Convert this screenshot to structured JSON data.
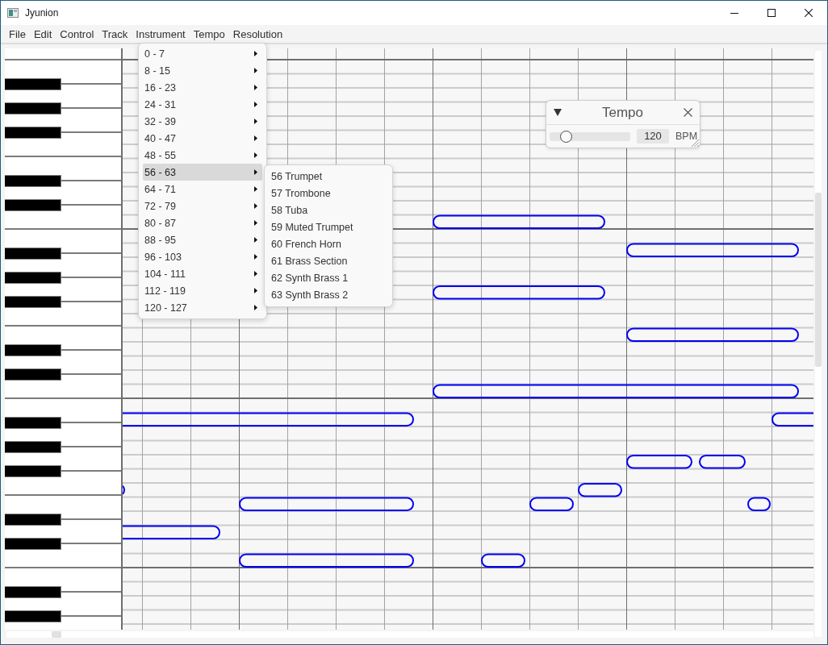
{
  "window": {
    "title": "Jyunion"
  },
  "menu_bar": [
    "File",
    "Edit",
    "Control",
    "Track",
    "Instrument",
    "Tempo",
    "Resolution"
  ],
  "instrument_menu": {
    "items": [
      {
        "label": "0 - 7",
        "selected": false
      },
      {
        "label": "8 - 15",
        "selected": false
      },
      {
        "label": "16 - 23",
        "selected": false
      },
      {
        "label": "24 - 31",
        "selected": false
      },
      {
        "label": "32 - 39",
        "selected": false
      },
      {
        "label": "40 - 47",
        "selected": false
      },
      {
        "label": "48 - 55",
        "selected": false
      },
      {
        "label": "56 - 63",
        "selected": true
      },
      {
        "label": "64 - 71",
        "selected": false
      },
      {
        "label": "72 - 79",
        "selected": false
      },
      {
        "label": "80 - 87",
        "selected": false
      },
      {
        "label": "88 - 95",
        "selected": false
      },
      {
        "label": "96 - 103",
        "selected": false
      },
      {
        "label": "104 - 111",
        "selected": false
      },
      {
        "label": "112 - 119",
        "selected": false
      },
      {
        "label": "120 - 127",
        "selected": false
      }
    ]
  },
  "instrument_submenu": {
    "items": [
      "56 Trumpet",
      "57 Trombone",
      "58 Tuba",
      "59 Muted Trumpet",
      "60 French Horn",
      "61 Brass Section",
      "62 Synth Brass 1",
      "63 Synth Brass 2"
    ]
  },
  "tempo_dialog": {
    "title": "Tempo",
    "level": 0.15,
    "value": "120",
    "unit": "BPM"
  }
}
